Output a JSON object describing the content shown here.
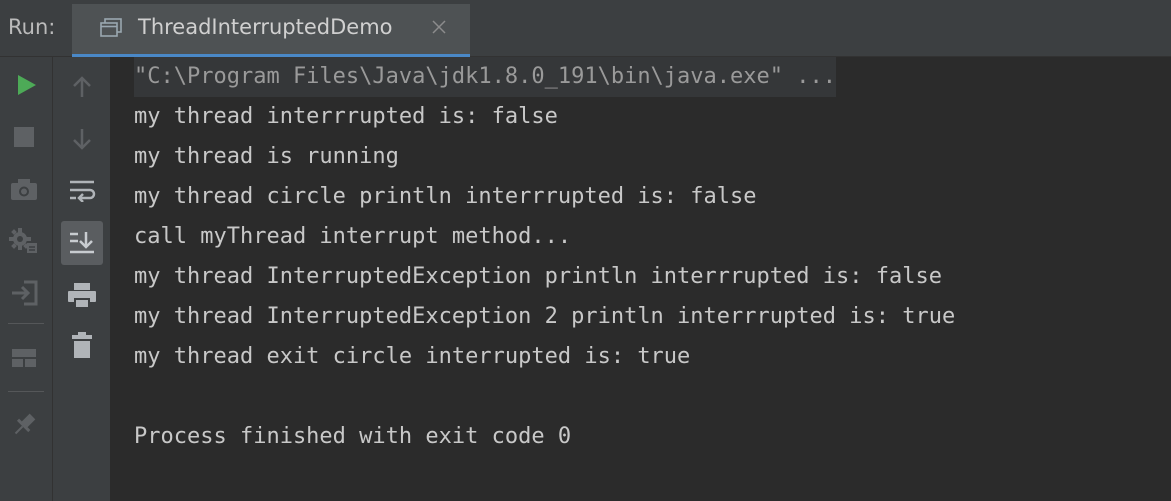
{
  "header": {
    "run_label": "Run:",
    "tab": {
      "title": "ThreadInterruptedDemo",
      "icon": "console-window-icon",
      "close_icon": "close-icon"
    }
  },
  "toolbar_left": {
    "buttons": [
      {
        "name": "rerun-button",
        "icon": "play-icon"
      },
      {
        "name": "stop-button",
        "icon": "stop-icon"
      },
      {
        "name": "dump-threads-button",
        "icon": "camera-icon"
      },
      {
        "name": "settings-button",
        "icon": "gear-bug-icon"
      },
      {
        "name": "exit-button",
        "icon": "exit-icon"
      },
      {
        "name": "layout-button",
        "icon": "layout-icon"
      },
      {
        "name": "pin-tab-button",
        "icon": "pin-icon"
      }
    ]
  },
  "toolbar_right": {
    "buttons": [
      {
        "name": "up-stack-button",
        "icon": "arrow-up-icon"
      },
      {
        "name": "down-stack-button",
        "icon": "arrow-down-icon"
      },
      {
        "name": "soft-wrap-button",
        "icon": "soft-wrap-icon"
      },
      {
        "name": "scroll-to-end-button",
        "icon": "scroll-to-end-icon",
        "active": true
      },
      {
        "name": "print-button",
        "icon": "print-icon"
      },
      {
        "name": "clear-all-button",
        "icon": "trash-icon"
      }
    ]
  },
  "console": {
    "command": "\"C:\\Program Files\\Java\\jdk1.8.0_191\\bin\\java.exe\" ...",
    "lines": [
      "my thread interrrupted is: false",
      "my thread is running",
      "my thread circle println interrrupted is: false",
      "call myThread interrupt method...",
      "my thread InterruptedException println interrrupted is: false",
      "my thread InterruptedException 2 println interrrupted is: true",
      "my thread exit circle interrupted is: true",
      "",
      "Process finished with exit code 0"
    ]
  },
  "colors": {
    "background": "#2b2b2b",
    "panel": "#3c3f41",
    "tab_active": "#4e5254",
    "tab_underline": "#4a88c7",
    "play_green": "#4daa57",
    "text": "#c8c8c8",
    "muted": "#9a9a9a"
  }
}
